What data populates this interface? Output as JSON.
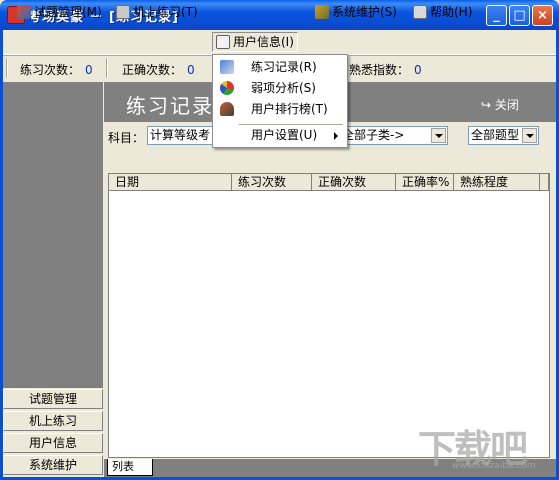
{
  "window": {
    "title": "考场英豪 － [练习记录]",
    "minimize": "_",
    "maximize": "□",
    "close": "×"
  },
  "menubar": [
    {
      "label": "试题管理(M)",
      "icon": "exam-management-icon"
    },
    {
      "label": "机上练习(T)",
      "icon": "computer-practice-icon"
    },
    {
      "label": "用户信息(I)",
      "icon": "user-info-icon"
    },
    {
      "label": "系统维护(S)",
      "icon": "system-maintenance-icon"
    },
    {
      "label": "帮助(H)",
      "icon": "help-icon"
    }
  ],
  "stats": {
    "practice_count_label": "练习次数：",
    "practice_count": "0",
    "correct_count_label": "正确次数：",
    "correct_count": "0",
    "familiarity_label": "熟悉指数：",
    "familiarity": "0"
  },
  "user_info_menu": [
    {
      "label": "练习记录(R)",
      "icon": "practice-record-icon"
    },
    {
      "label": "弱项分析(S)",
      "icon": "weakness-analysis-icon"
    },
    {
      "label": "用户排行榜(T)",
      "icon": "user-ranking-icon"
    },
    {
      "label": "用户设置(U)",
      "icon": "",
      "submenu": true
    }
  ],
  "panel": {
    "title": "练习记录",
    "close_label": "关闭",
    "subject_label": "科目：",
    "subject_value": "计算等级考",
    "subcategory_value": "全部子类->",
    "question_type_value": "全部题型"
  },
  "table": {
    "columns": [
      "日期",
      "练习次数",
      "正确次数",
      "正确率%",
      "熟练程度"
    ],
    "rows": []
  },
  "sidebar": [
    {
      "label": "试题管理"
    },
    {
      "label": "机上练习"
    },
    {
      "label": "用户信息"
    },
    {
      "label": "系统维护"
    }
  ],
  "bottom_tab": "列表",
  "watermark": {
    "text": "下载吧",
    "sub": "www.xiazaiba.com"
  },
  "colors": {
    "titlebar": "#0a4fd6",
    "panel_bg": "#808080",
    "stat_value": "#0a33c0",
    "window_bg": "#ece9d8"
  }
}
